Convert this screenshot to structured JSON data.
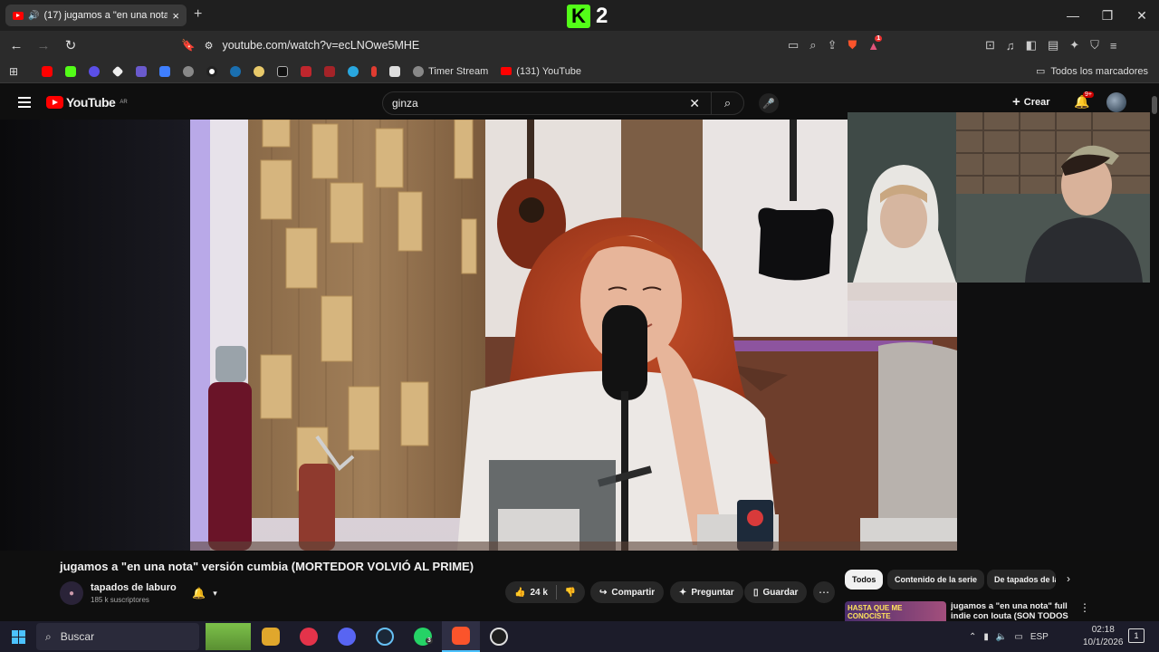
{
  "browser": {
    "tab_title": "(17) jugamos a \"en una nota\"",
    "tab_close": "×",
    "new_tab": "+",
    "overlay_logo_letter": "K",
    "overlay_logo_number": "2",
    "url": "youtube.com/watch?v=ecLNOwe5MHE",
    "extension_badge": "1",
    "bookmarks": [
      "Timer Stream",
      "(131) YouTube"
    ],
    "all_bookmarks": "Todos los marcadores"
  },
  "youtube": {
    "logo_text": "YouTube",
    "logo_region": "AR",
    "search_query": "ginza",
    "create_label": "Crear",
    "notifications_badge": "9+",
    "video_title": "jugamos a \"en una nota\" versión cumbia (MORTEDOR VOLVIÓ AL PRIME)",
    "channel_name": "tapados de laburo",
    "channel_subs": "185 k suscriptores",
    "likes": "24 k",
    "share_label": "Compartir",
    "ask_label": "Preguntar",
    "save_label": "Guardar",
    "chips": [
      "Todos",
      "Contenido de la serie",
      "De tapados de laburo"
    ],
    "recommended": {
      "thumb_text": "HASTA QUE ME CONOCISTE",
      "title": "jugamos a \"en una nota\" full indie con louta (SON TODOS"
    }
  },
  "taskbar": {
    "search_placeholder": "Buscar",
    "lang": "ESP",
    "time": "02:18",
    "date": "10/1/2026",
    "whatsapp_badge": "3",
    "notification_count": "1"
  },
  "colors": {
    "youtube_red": "#ff0000",
    "kick_green": "#53fc18",
    "accent_blue": "#4cc2ff"
  }
}
